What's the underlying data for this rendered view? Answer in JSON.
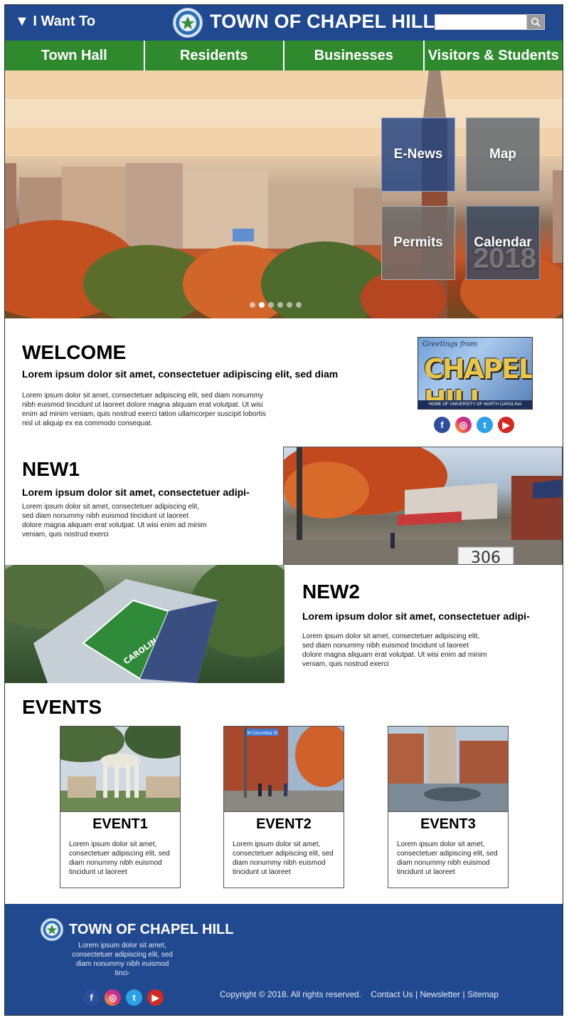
{
  "header": {
    "i_want_to": "▼ I Want To",
    "brand": "TOWN OF CHAPEL HILL",
    "search_placeholder": ""
  },
  "nav": {
    "items": [
      "Town Hall",
      "Residents",
      "Businesses",
      "Visitors & Students"
    ]
  },
  "hero": {
    "tiles": {
      "enews": "E-News",
      "map": "Map",
      "permits": "Permits",
      "calendar": "Calendar",
      "calendar_year": "2018"
    },
    "slide_count": 6,
    "active_slide": 2
  },
  "welcome": {
    "title": "WELCOME",
    "subtitle": "Lorem ipsum dolor sit amet, consectetuer adipiscing elit, sed diam",
    "body": "Lorem ipsum dolor sit amet, consectetuer adipiscing elit, sed diam nonummy nibh euismod tincidunt ut laoreet dolore magna aliquam erat volutpat. Ut wisi enim ad minim veniam, quis nostrud exerci tation ullamcorper suscipit lobortis nisl ut aliquip ex ea commodo consequat.",
    "postcard": {
      "greeting": "Greetings from",
      "name": "CHAPEL HILL",
      "caption": "HOME OF UNIVERSITY OF NORTH CAROLINA"
    }
  },
  "new1": {
    "title": "NEW1",
    "subtitle": "Lorem ipsum dolor sit amet, consectetuer adipi-",
    "body": "Lorem ipsum dolor sit amet, consectetuer adipiscing elit, sed diam nonummy nibh euismod tincidunt ut laoreet dolore magna aliquam erat volutpat. Ut wisi enim ad minim veniam, quis nostrud exerci",
    "sign_number": "306"
  },
  "new2": {
    "title": "NEW2",
    "subtitle": "Lorem ipsum dolor sit amet, consectetuer adipi-",
    "body": "Lorem ipsum dolor sit amet, consectetuer adipiscing elit, sed diam nonummy nibh euismod tincidunt ut laoreet dolore magna aliquam erat volutpat. Ut wisi enim ad minim veniam, quis nostrud exerci",
    "field_text": "CAROLINA"
  },
  "events": {
    "title": "EVENTS",
    "items": [
      {
        "title": "EVENT1",
        "desc": "Lorem ipsum dolor sit amet, consectetuer adipiscing elit, sed diam nonummy nibh euismod tincidunt ut laoreet"
      },
      {
        "title": "EVENT2",
        "desc": "Lorem ipsum dolor sit amet, consectetuer adipiscing elit, sed diam nonummy nibh euismod tincidunt ut laoreet",
        "street_sign": "N Columbia St"
      },
      {
        "title": "EVENT3",
        "desc": "Lorem ipsum dolor sit amet, consectetuer adipiscing elit, sed diam nonummy nibh euismod tincidunt ut laoreet"
      }
    ]
  },
  "footer": {
    "brand": "TOWN OF CHAPEL HILL",
    "desc": "Lorem ipsum dolor sit amet, consectetuer adipiscing elit, sed diam nonummy nibh euismod tinci-",
    "copyright": "Copyright © 2018.  All rights reserved.",
    "contact": "Contact Us",
    "newsletter": "Newsletter",
    "sitemap": "Sitemap",
    "separator": "|"
  },
  "social": {
    "facebook": "f",
    "instagram": "◎",
    "twitter": "t",
    "youtube": "▶"
  },
  "colors": {
    "header_blue": "#21498f",
    "nav_green": "#2f8a2e"
  },
  "icons": [
    "search-icon",
    "town-seal-icon",
    "facebook-icon",
    "instagram-icon",
    "twitter-icon",
    "youtube-icon",
    "caret-down-icon"
  ]
}
